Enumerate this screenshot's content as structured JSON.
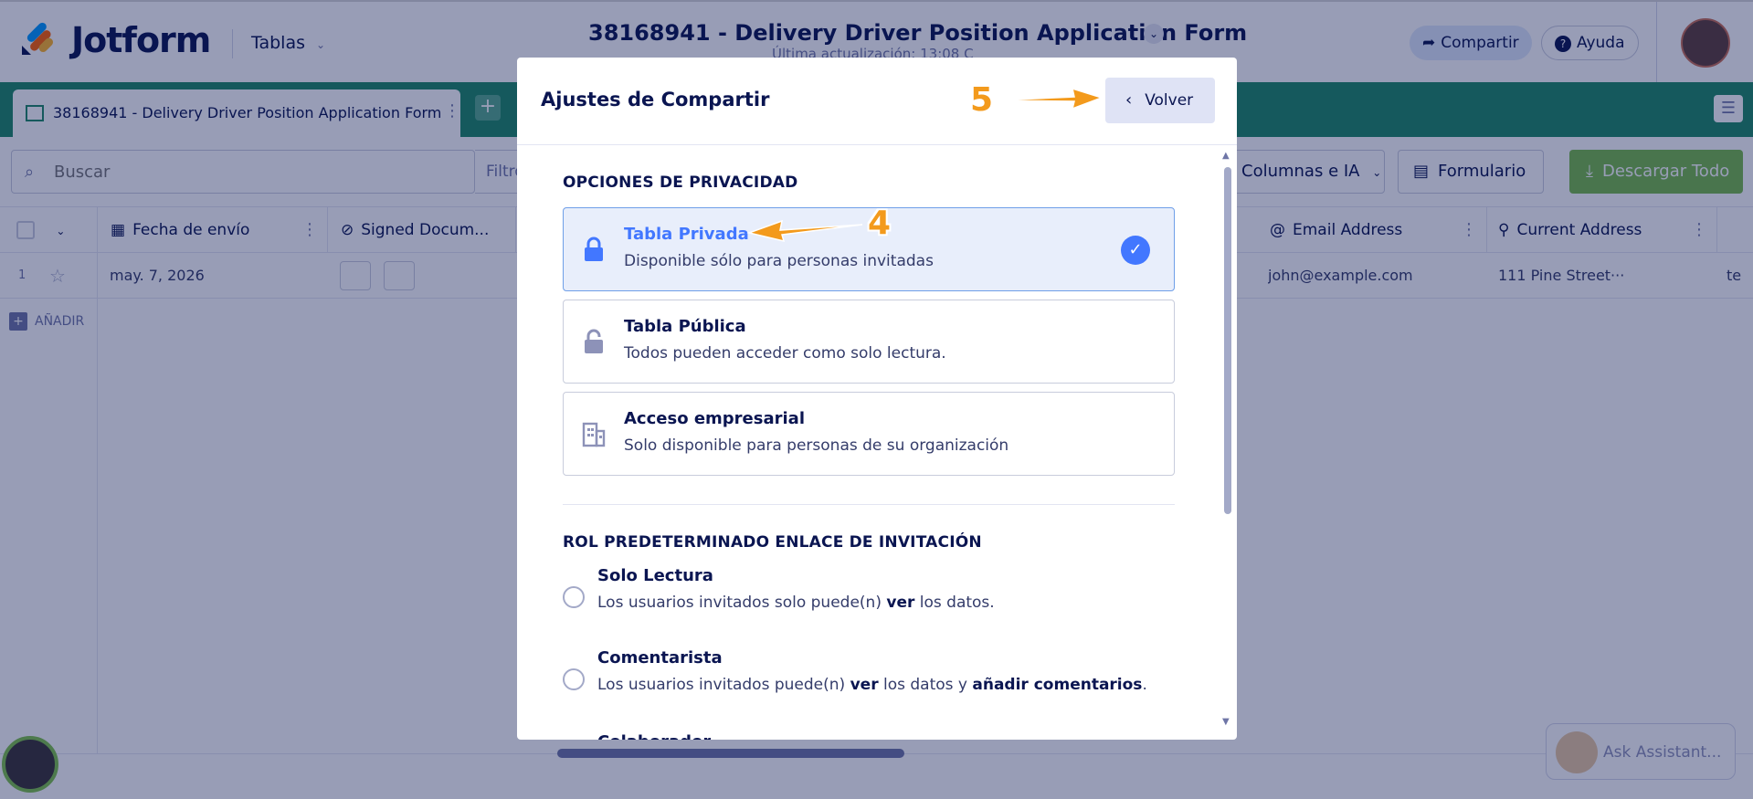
{
  "app": {
    "brand": "Jotform",
    "tables_menu": "Tablas",
    "form_title": "38168941 - Delivery Driver Position Application Form",
    "last_update": "Última actualización: 13:08 C",
    "share_label": "Compartir",
    "help_label": "Ayuda"
  },
  "tabs": {
    "active_label": "38168941 - Delivery Driver Position Application Form",
    "add_label": "+ N"
  },
  "toolbar": {
    "search_placeholder": "Buscar",
    "filter_label": "Filtro",
    "columns_label": "Columnas e IA",
    "form_label": "Formulario",
    "download_label": "Descargar Todo"
  },
  "grid": {
    "columns": [
      {
        "label": "Fecha de envío",
        "icon": "calendar-icon"
      },
      {
        "label": "Signed Docum...",
        "icon": "paperclip-icon"
      },
      {
        "label": "Email Address",
        "icon": "at-icon"
      },
      {
        "label": "Current Address",
        "icon": "location-pin-icon"
      }
    ],
    "rows": [
      {
        "number": "1",
        "date": "may. 7, 2026",
        "email": "john@example.com",
        "address": "111 Pine Street···",
        "extra": "te"
      }
    ],
    "add_row_label": "AÑADIR"
  },
  "assistant": {
    "label": "Ask Assistant..."
  },
  "modal": {
    "title": "Ajustes de Compartir",
    "back_label": "Volver",
    "privacy_section_title": "OPCIONES DE PRIVACIDAD",
    "privacy_options": [
      {
        "title": "Tabla Privada",
        "desc": "Disponible sólo para personas invitadas",
        "icon": "lock-icon",
        "selected": true
      },
      {
        "title": "Tabla Pública",
        "desc": "Todos pueden acceder como solo lectura.",
        "icon": "unlock-icon",
        "selected": false
      },
      {
        "title": "Acceso empresarial",
        "desc": "Solo disponible para personas de su organización",
        "icon": "building-icon",
        "selected": false
      }
    ],
    "role_section_title": "ROL PREDETERMINADO ENLACE DE INVITACIÓN",
    "roles": [
      {
        "title": "Solo Lectura",
        "desc_pre": "Los usuarios invitados solo puede(n) ",
        "desc_b1": "ver",
        "desc_mid": " los datos.",
        "desc_b2": "",
        "desc_post": ""
      },
      {
        "title": "Comentarista",
        "desc_pre": "Los usuarios invitados puede(n) ",
        "desc_b1": "ver",
        "desc_mid": " los datos y ",
        "desc_b2": "añadir comentarios",
        "desc_post": "."
      }
    ],
    "cut_off_role": "Colaborador"
  },
  "annotations": {
    "step_back": "5",
    "step_private": "4",
    "color": "#f39a1c"
  },
  "colors": {
    "brand_green": "#1e8a66",
    "accent_blue": "#4277ff",
    "download_green": "#78bb4a",
    "navy": "#0a1551"
  }
}
